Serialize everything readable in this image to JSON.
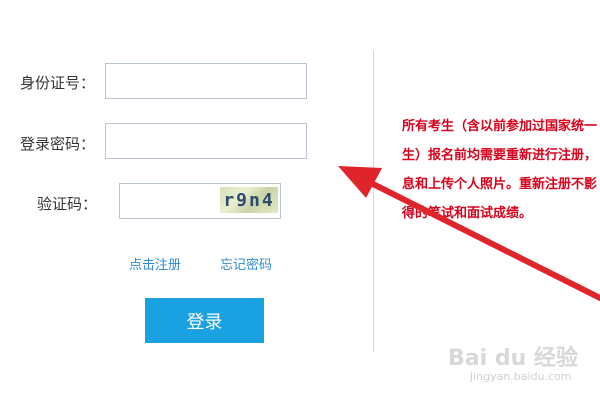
{
  "form": {
    "id_label": "身份证号：",
    "password_label": "登录密码：",
    "captcha_label": "验证码：",
    "id_value": "",
    "password_value": "",
    "captcha_value": "",
    "captcha_image_text": "r9n4",
    "register_link": "点击注册",
    "forgot_link": "忘记密码",
    "login_button": "登录"
  },
  "notice": {
    "lines": [
      "所有考生（含以前参加过国家统一",
      "生）报名前均需要重新进行注册，",
      "息和上传个人照片。重新注册不影",
      "得的笔试和面试成绩。"
    ]
  },
  "watermark": {
    "brand": "Bai du 经验",
    "url": "jingyan.baidu.com"
  },
  "colors": {
    "notice_text": "#d9001b",
    "button_bg": "#1aa1e1",
    "link": "#2e8bd0",
    "arrow": "#e0242b"
  }
}
